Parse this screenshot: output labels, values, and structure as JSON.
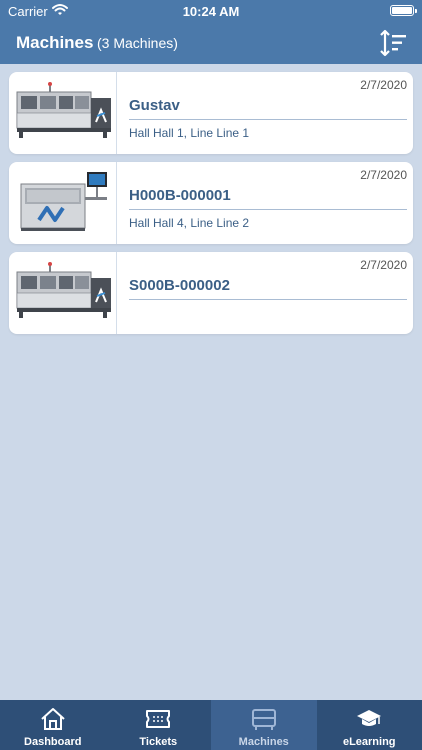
{
  "status_bar": {
    "carrier": "Carrier",
    "time": "10:24 AM"
  },
  "header": {
    "title": "Machines",
    "subtitle": "(3 Machines)",
    "sort_icon": "sort-icon"
  },
  "machines": [
    {
      "date": "2/7/2020",
      "name": "Gustav",
      "location": "Hall Hall 1, Line Line 1",
      "image": "wave-solder-machine"
    },
    {
      "date": "2/7/2020",
      "name": "H000B-000001",
      "location": "Hall Hall 4, Line Line 2",
      "image": "selective-solder-machine"
    },
    {
      "date": "2/7/2020",
      "name": "S000B-000002",
      "location": "",
      "image": "wave-solder-machine"
    }
  ],
  "tabs": [
    {
      "label": "Dashboard",
      "icon": "home-icon"
    },
    {
      "label": "Tickets",
      "icon": "ticket-icon"
    },
    {
      "label": "Machines",
      "icon": "machine-icon",
      "active": true
    },
    {
      "label": "eLearning",
      "icon": "graduation-cap-icon"
    }
  ],
  "colors": {
    "header": "#4b79aa",
    "background": "#ccd8e8",
    "tabbar": "#2e4f77",
    "accent_text": "#3b5f86"
  }
}
